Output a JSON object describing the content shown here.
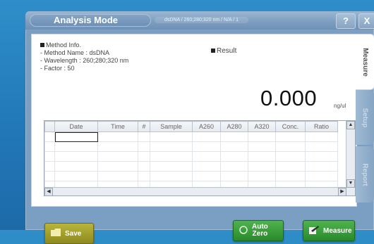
{
  "window": {
    "title": "Analysis Mode",
    "subtitle": "dsDNA / 260;280;320 nm / N/A / 1",
    "help_label": "?",
    "close_label": "X"
  },
  "method_info": {
    "heading": "Method Info.",
    "name_line": "- Method Name : dsDNA",
    "wavelength_line": "- Wavelength : 260;280;320 nm",
    "factor_line": "- Factor : 50"
  },
  "result": {
    "heading": "Result",
    "value": "0.000",
    "unit": "ng/ul"
  },
  "table": {
    "columns": [
      "",
      "Date",
      "Time",
      "#",
      "Sample",
      "A260",
      "A280",
      "A320",
      "Conc.",
      "Ratio"
    ],
    "row_count": 6
  },
  "tabs": [
    {
      "label": "Measure",
      "active": true
    },
    {
      "label": "Setup",
      "active": false
    },
    {
      "label": "Report",
      "active": false
    }
  ],
  "buttons": {
    "save": "Save",
    "autozero_line1": "Auto",
    "autozero_line2": "Zero",
    "measure": "Measure"
  },
  "colors": {
    "background": "#2278b8",
    "panel": "#7b9fc2",
    "save_button": "#a7a32c",
    "green_button": "#3a9e3a"
  }
}
